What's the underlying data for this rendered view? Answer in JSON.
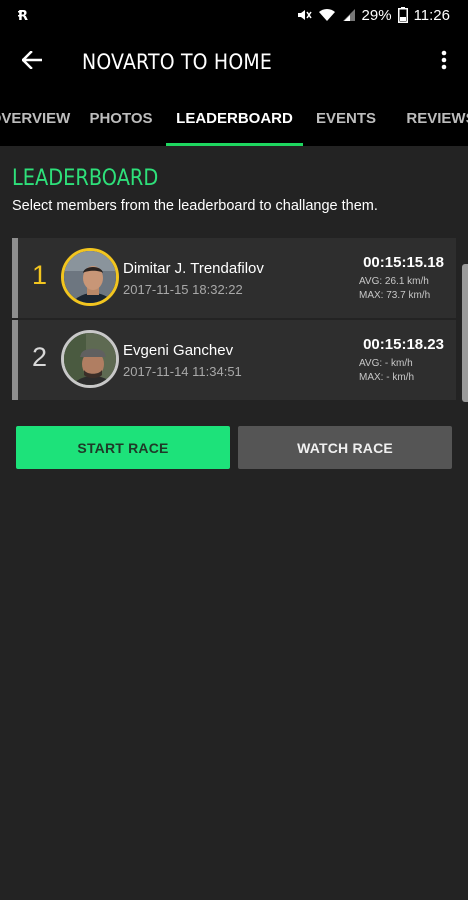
{
  "status_bar": {
    "left_icon": "r-badge-icon",
    "battery_percent": "29%",
    "time": "11:26"
  },
  "app_bar": {
    "title": "NOVARTO TO HOME"
  },
  "tabs": [
    {
      "label": "OVERVIEW",
      "active": false
    },
    {
      "label": "PHOTOS",
      "active": false
    },
    {
      "label": "LEADERBOARD",
      "active": true
    },
    {
      "label": "EVENTS",
      "active": false
    },
    {
      "label": "REVIEWS",
      "active": false
    }
  ],
  "leaderboard": {
    "title": "LEADERBOARD",
    "subtitle": "Select members from the leaderboard to challange them.",
    "entries": [
      {
        "rank": "1",
        "name": "Dimitar J. Trendafilov",
        "date": "2017-11-15 18:32:22",
        "time": "00:15:15.18",
        "avg": "AVG: 26.1 km/h",
        "max": "MAX: 73.7 km/h"
      },
      {
        "rank": "2",
        "name": "Evgeni Ganchev",
        "date": "2017-11-14 11:34:51",
        "time": "00:15:18.23",
        "avg": "AVG: - km/h",
        "max": "MAX: - km/h"
      }
    ]
  },
  "actions": {
    "start_label": "START RACE",
    "watch_label": "WATCH RACE"
  },
  "colors": {
    "accent": "#1de27a",
    "gold": "#f2c51f",
    "background": "#232323"
  }
}
